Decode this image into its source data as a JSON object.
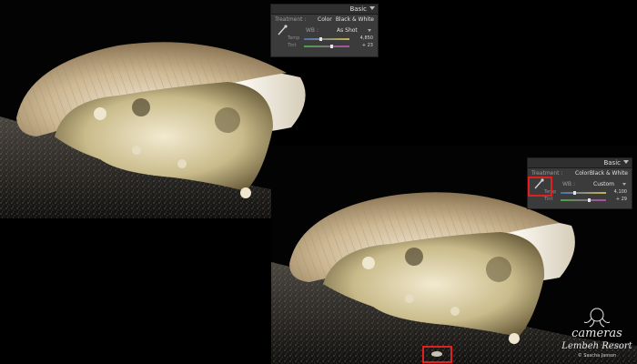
{
  "panel_top": {
    "title": "Basic",
    "treatment_label": "Treatment :",
    "treatment_color": "Color",
    "treatment_bw": "Black & White",
    "wb_label": "WB :",
    "wb_value": "As Shot",
    "temp_label": "Temp",
    "temp_value": "4,850",
    "tint_label": "Tint",
    "tint_value": "+ 23"
  },
  "panel_bottom": {
    "title": "Basic",
    "treatment_label": "Treatment :",
    "treatment_color": "Color",
    "treatment_bw": "Black & White",
    "wb_label": "WB :",
    "wb_value": "Custom",
    "temp_label": "Temp",
    "temp_value": "4,100",
    "tint_label": "Tint",
    "tint_value": "+ 29"
  },
  "logo": {
    "line1": "cameras",
    "line2": "Lembeh Resort",
    "line3": "© Sascha Janson"
  },
  "colors": {
    "highlight": "#e02020",
    "panel_bg": "#3b3b3b"
  }
}
